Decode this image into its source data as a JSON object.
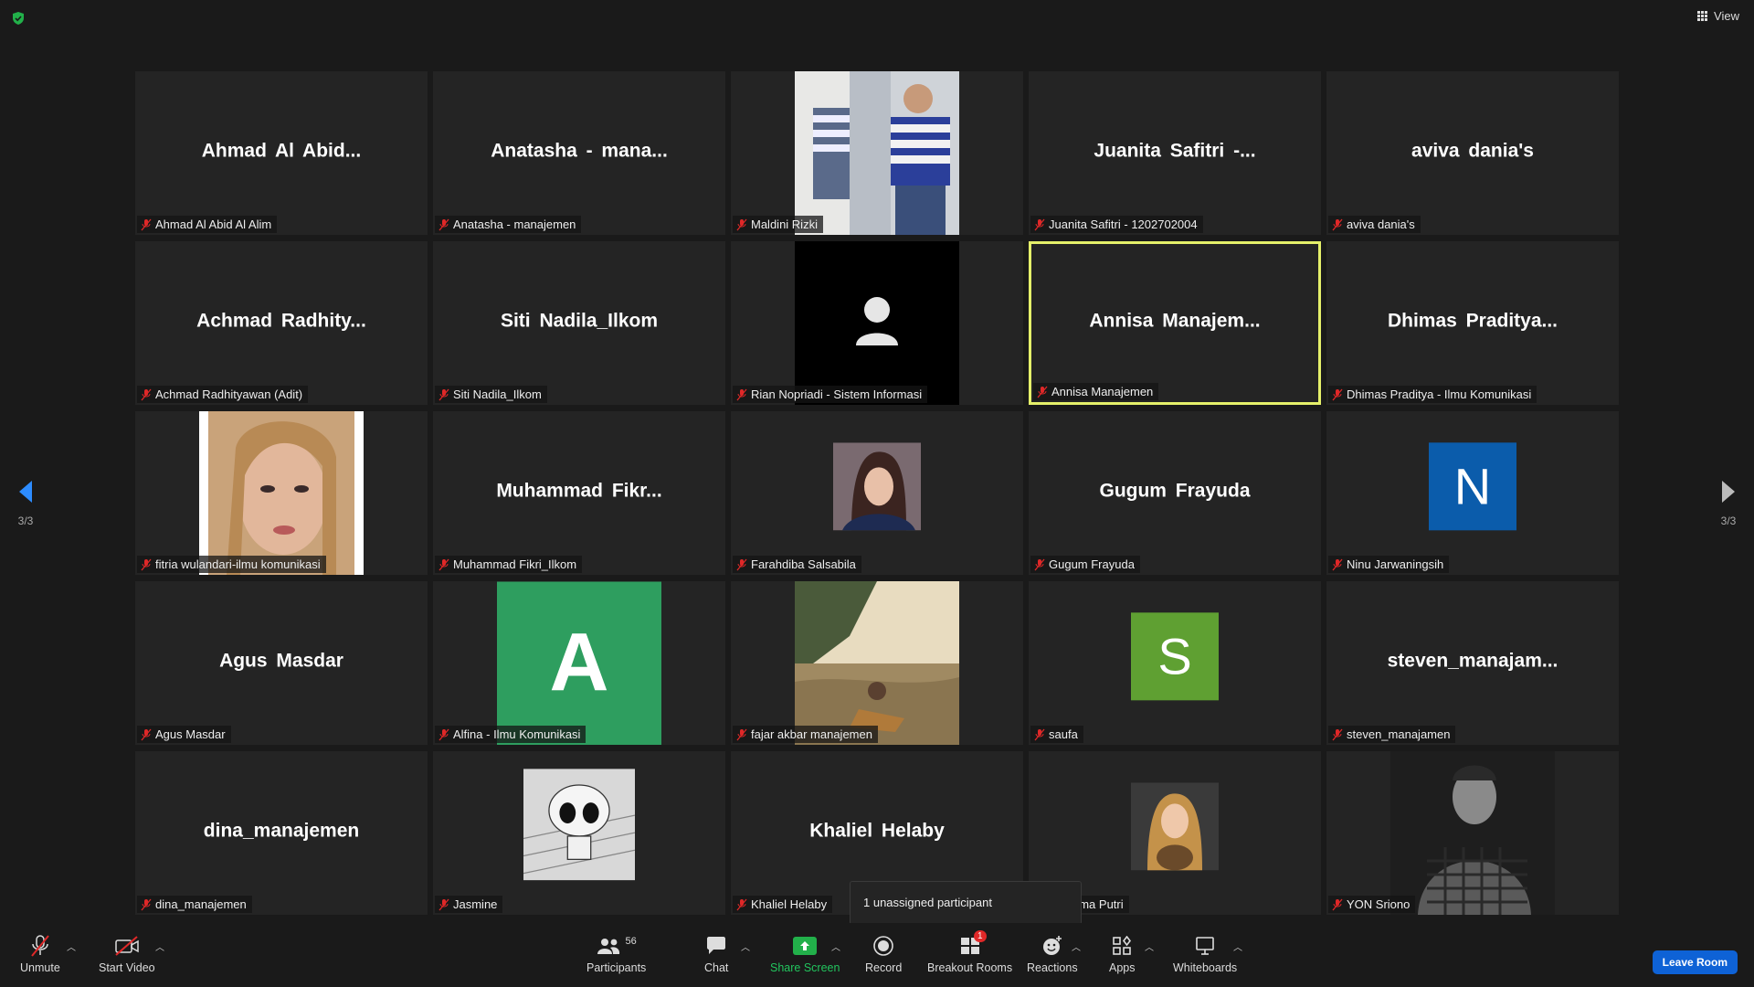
{
  "header": {
    "view_label": "View"
  },
  "pagination": {
    "left_page": "3/3",
    "right_page": "3/3"
  },
  "tiles": [
    {
      "big_name": "Ahmad  Al  Abid...",
      "label": "Ahmad Al Abid Al Alim"
    },
    {
      "big_name": "Anatasha  -  mana...",
      "label": "Anatasha - manajemen"
    },
    {
      "big_name": "",
      "label": "Maldini Rizki"
    },
    {
      "big_name": "Juanita  Safitri  -...",
      "label": "Juanita Safitri - 1202702004"
    },
    {
      "big_name": "aviva  dania's",
      "label": "aviva dania's"
    },
    {
      "big_name": "Achmad  Radhity...",
      "label": "Achmad Radhityawan (Adit)"
    },
    {
      "big_name": "Siti Nadila_Ilkom",
      "label": "Siti Nadila_Ilkom"
    },
    {
      "big_name": "",
      "label": "Rian Nopriadi - Sistem Informasi"
    },
    {
      "big_name": "Annisa  Manajem...",
      "label": "Annisa Manajemen"
    },
    {
      "big_name": "Dhimas  Praditya...",
      "label": "Dhimas Praditya - Ilmu Komunikasi"
    },
    {
      "big_name": "",
      "label": "fitria wulandari-ilmu komunikasi"
    },
    {
      "big_name": "Muhammad  Fikr...",
      "label": "Muhammad Fikri_Ilkom"
    },
    {
      "big_name": "",
      "label": "Farahdiba Salsabila"
    },
    {
      "big_name": "Gugum Frayuda",
      "label": "Gugum Frayuda"
    },
    {
      "big_name": "",
      "label": "Ninu Jarwaningsih",
      "avatar_letter": "N",
      "avatar_color": "#0b5cab"
    },
    {
      "big_name": "Agus Masdar",
      "label": "Agus Masdar"
    },
    {
      "big_name": "",
      "label": "Alfina - Ilmu Komunikasi",
      "avatar_letter": "A",
      "avatar_color": "#2e9e5f"
    },
    {
      "big_name": "",
      "label": "fajar akbar manajemen"
    },
    {
      "big_name": "",
      "label": "saufa",
      "avatar_letter": "S",
      "avatar_color": "#5fa032"
    },
    {
      "big_name": "steven_manajam...",
      "label": "steven_manajamen"
    },
    {
      "big_name": "dina_manajemen",
      "label": "dina_manajemen"
    },
    {
      "big_name": "",
      "label": "Jasmine"
    },
    {
      "big_name": "Khaliel Helaby",
      "label": "Khaliel Helaby"
    },
    {
      "big_name": "",
      "label": "y Karima Putri"
    },
    {
      "big_name": "",
      "label": "YON Sriono"
    }
  ],
  "tooltip": {
    "text": "1 unassigned participant"
  },
  "toolbar": {
    "unmute": "Unmute",
    "start_video": "Start Video",
    "participants": "Participants",
    "participants_count": "56",
    "chat": "Chat",
    "share_screen": "Share Screen",
    "record": "Record",
    "breakout_rooms": "Breakout Rooms",
    "breakout_badge": "1",
    "reactions": "Reactions",
    "apps": "Apps",
    "whiteboards": "Whiteboards",
    "leave": "Leave Room"
  },
  "colors": {
    "background": "#1a1a1a",
    "tile": "#242424",
    "active_speaker_border": "#e5f06a",
    "leave_button": "#0e62d6",
    "share_screen": "#22b04a",
    "muted_icon": "#e02828"
  }
}
